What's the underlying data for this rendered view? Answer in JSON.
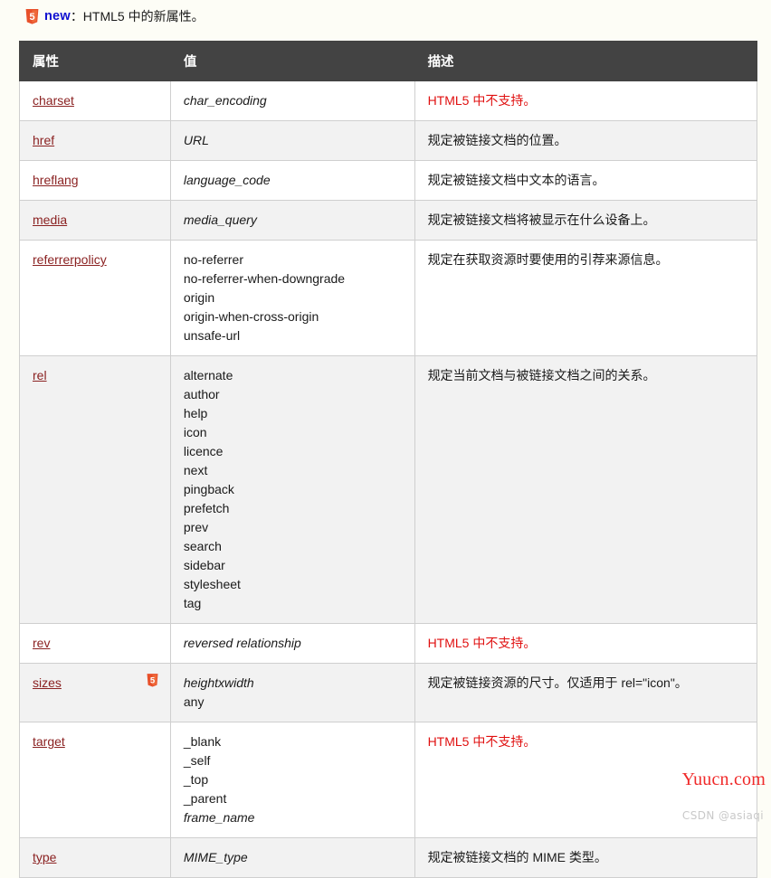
{
  "note": {
    "badge_icon": "html5-badge-icon",
    "new_label": "new",
    "text": "：HTML5 中的新属性。"
  },
  "table": {
    "columns": [
      "属性",
      "值",
      "描述"
    ],
    "rows": [
      {
        "attribute": "charset",
        "badge": false,
        "values": [
          {
            "text": "char_encoding",
            "italic": true
          }
        ],
        "description": "HTML5 中不支持。",
        "description_red": true
      },
      {
        "attribute": "href",
        "badge": false,
        "values": [
          {
            "text": "URL",
            "italic": true
          }
        ],
        "description": "规定被链接文档的位置。",
        "description_red": false
      },
      {
        "attribute": "hreflang",
        "badge": false,
        "values": [
          {
            "text": "language_code",
            "italic": true
          }
        ],
        "description": "规定被链接文档中文本的语言。",
        "description_red": false
      },
      {
        "attribute": "media",
        "badge": false,
        "values": [
          {
            "text": "media_query",
            "italic": true
          }
        ],
        "description": "规定被链接文档将被显示在什么设备上。",
        "description_red": false
      },
      {
        "attribute": "referrerpolicy",
        "badge": false,
        "values": [
          {
            "text": "no-referrer",
            "italic": false
          },
          {
            "text": "no-referrer-when-downgrade",
            "italic": false
          },
          {
            "text": "origin",
            "italic": false
          },
          {
            "text": "origin-when-cross-origin",
            "italic": false
          },
          {
            "text": "unsafe-url",
            "italic": false
          }
        ],
        "description": "规定在获取资源时要使用的引荐来源信息。",
        "description_red": false
      },
      {
        "attribute": "rel",
        "badge": false,
        "values": [
          {
            "text": "alternate",
            "italic": false
          },
          {
            "text": "author",
            "italic": false
          },
          {
            "text": "help",
            "italic": false
          },
          {
            "text": "icon",
            "italic": false
          },
          {
            "text": "licence",
            "italic": false
          },
          {
            "text": "next",
            "italic": false
          },
          {
            "text": "pingback",
            "italic": false
          },
          {
            "text": "prefetch",
            "italic": false
          },
          {
            "text": "prev",
            "italic": false
          },
          {
            "text": "search",
            "italic": false
          },
          {
            "text": "sidebar",
            "italic": false
          },
          {
            "text": "stylesheet",
            "italic": false
          },
          {
            "text": "tag",
            "italic": false
          }
        ],
        "description": "规定当前文档与被链接文档之间的关系。",
        "description_red": false
      },
      {
        "attribute": "rev",
        "badge": false,
        "values": [
          {
            "text": "reversed relationship",
            "italic": true
          }
        ],
        "description": "HTML5 中不支持。",
        "description_red": true
      },
      {
        "attribute": "sizes",
        "badge": true,
        "values": [
          {
            "text": "heightxwidth",
            "italic": true
          },
          {
            "text": "any",
            "italic": false
          }
        ],
        "description": "规定被链接资源的尺寸。仅适用于 rel=\"icon\"。",
        "description_red": false
      },
      {
        "attribute": "target",
        "badge": false,
        "values": [
          {
            "text": "_blank",
            "italic": false
          },
          {
            "text": "_self",
            "italic": false
          },
          {
            "text": "_top",
            "italic": false
          },
          {
            "text": "_parent",
            "italic": false
          },
          {
            "text": "frame_name",
            "italic": true
          }
        ],
        "description": "HTML5 中不支持。",
        "description_red": true
      },
      {
        "attribute": "type",
        "badge": false,
        "values": [
          {
            "text": "MIME_type",
            "italic": true
          }
        ],
        "description": "规定被链接文档的 MIME 类型。",
        "description_red": false
      }
    ]
  },
  "watermarks": {
    "site": "Yuucn.com",
    "author": "CSDN @asiaqi"
  },
  "colors": {
    "header_bg": "#434343",
    "link": "#8b2222",
    "red_note": "#e01010",
    "new_blue": "#1010d0",
    "row_alt": "#f2f2f2",
    "page_bg": "#fdfdf6"
  }
}
